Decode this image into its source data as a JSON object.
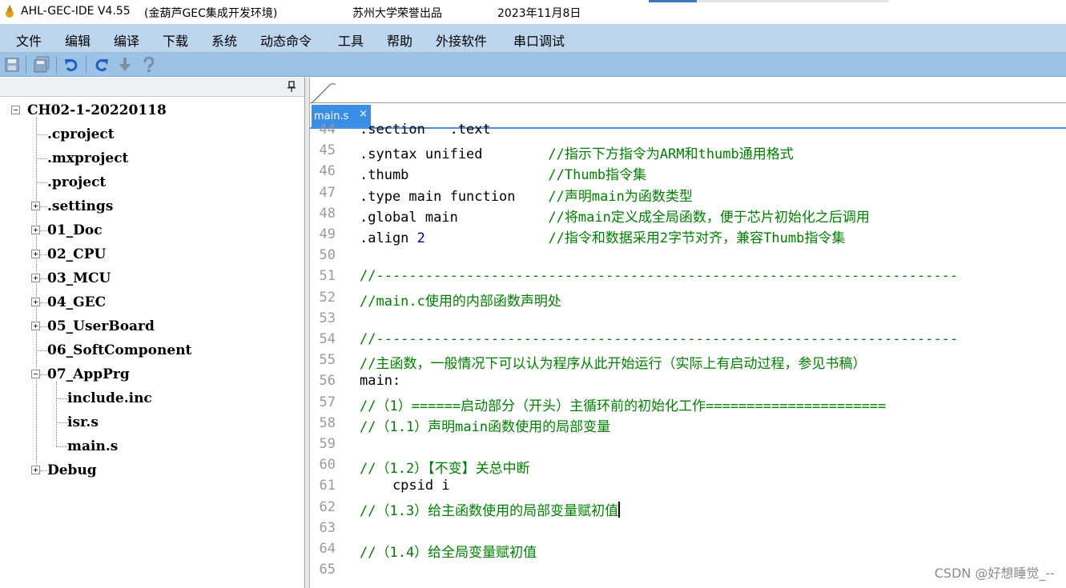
{
  "window": {
    "title_app": "AHL-GEC-IDE V4.55",
    "title_desc": "(金葫芦GEC集成开发环境)",
    "title_org": "苏州大学荣誉出品",
    "title_date": "2023年11月8日"
  },
  "menu": {
    "items": [
      "文件",
      "编辑",
      "编译",
      "下载",
      "系统",
      "动态命令",
      "工具",
      "帮助",
      "外接软件",
      "串口调试"
    ]
  },
  "toolbar": {
    "buttons": [
      "save-icon",
      "save-all-icon",
      "undo-icon",
      "redo-icon",
      "download-icon",
      "help-icon"
    ]
  },
  "tree": {
    "root": "CH02-1-20220118",
    "nodes": [
      {
        "label": ".cproject",
        "expandable": false
      },
      {
        "label": ".mxproject",
        "expandable": false
      },
      {
        "label": ".project",
        "expandable": false
      },
      {
        "label": ".settings",
        "expandable": true
      },
      {
        "label": "01_Doc",
        "expandable": true
      },
      {
        "label": "02_CPU",
        "expandable": true
      },
      {
        "label": "03_MCU",
        "expandable": true
      },
      {
        "label": "04_GEC",
        "expandable": true
      },
      {
        "label": "05_UserBoard",
        "expandable": true
      },
      {
        "label": "06_SoftComponent",
        "expandable": false
      },
      {
        "label": "07_AppPrg",
        "expandable": true,
        "expanded": true
      },
      {
        "label": "include.inc",
        "expandable": false,
        "child": true
      },
      {
        "label": "isr.s",
        "expandable": false,
        "child": true
      },
      {
        "label": "main.s",
        "expandable": false,
        "child": true
      },
      {
        "label": "Debug",
        "expandable": true
      }
    ]
  },
  "editor": {
    "active_tab": "main.s",
    "tab_close": "×",
    "lines": [
      {
        "no": "44",
        "code": ".section   .text",
        "comment": ""
      },
      {
        "no": "45",
        "code": ".syntax unified        ",
        "comment": "//指示下方指令为ARM和thumb通用格式"
      },
      {
        "no": "46",
        "code": ".thumb                 ",
        "comment": "//Thumb指令集"
      },
      {
        "no": "47",
        "code": ".type main function    ",
        "comment": "//声明main为函数类型"
      },
      {
        "no": "48",
        "code": ".global main           ",
        "comment": "//将main定义成全局函数，便于芯片初始化之后调用"
      },
      {
        "no": "49",
        "code": ".align ",
        "num": "2",
        "pad": "               ",
        "comment": "//指令和数据采用2字节对齐，兼容Thumb指令集"
      },
      {
        "no": "50",
        "code": "",
        "comment": ""
      },
      {
        "no": "51",
        "code": "",
        "comment": "//-----------------------------------------------------------------------"
      },
      {
        "no": "52",
        "code": "",
        "comment": "//main.c使用的内部函数声明处"
      },
      {
        "no": "53",
        "code": "",
        "comment": ""
      },
      {
        "no": "54",
        "code": "",
        "comment": "//-----------------------------------------------------------------------"
      },
      {
        "no": "55",
        "code": "",
        "comment": "//主函数，一般情况下可以认为程序从此开始运行（实际上有启动过程，参见书稿）"
      },
      {
        "no": "56",
        "code": "main:",
        "comment": ""
      },
      {
        "no": "57",
        "code": "",
        "comment": "//（1）======启动部分（开头）主循环前的初始化工作======================"
      },
      {
        "no": "58",
        "code": "",
        "comment": "//（1.1）声明main函数使用的局部变量"
      },
      {
        "no": "59",
        "code": "",
        "comment": ""
      },
      {
        "no": "60",
        "code": "",
        "comment": "//（1.2）【不变】关总中断"
      },
      {
        "no": "61",
        "code": "    cpsid i",
        "comment": ""
      },
      {
        "no": "62",
        "code": "",
        "comment": "//（1.3）给主函数使用的局部变量赋初值",
        "caret": true
      },
      {
        "no": "63",
        "code": "",
        "comment": ""
      },
      {
        "no": "64",
        "code": "",
        "comment": "//（1.4）给全局变量赋初值"
      },
      {
        "no": "65",
        "code": "",
        "comment": ""
      }
    ]
  },
  "watermark": "CSDN @好想睡觉_--",
  "colors": {
    "menubar": "#bdd6ee",
    "toolbar": "#9cc2e5",
    "tab_active": "#3a8ee6",
    "comment": "#008000",
    "line_number": "#9a9a9a"
  }
}
